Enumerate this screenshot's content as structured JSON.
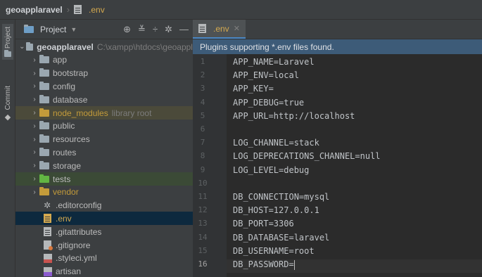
{
  "breadcrumb": {
    "project": "geoapplaravel",
    "file": ".env"
  },
  "toolstrip": {
    "project_label": "Project",
    "commit_label": "Commit"
  },
  "project_panel": {
    "title": "Project",
    "root": {
      "name": "geoapplaravel",
      "path": "C:\\xampp\\htdocs\\geoappl"
    },
    "folders": [
      {
        "name": "app"
      },
      {
        "name": "bootstrap"
      },
      {
        "name": "config"
      },
      {
        "name": "database"
      },
      {
        "name": "node_modules",
        "hint": "library root"
      },
      {
        "name": "public"
      },
      {
        "name": "resources"
      },
      {
        "name": "routes"
      },
      {
        "name": "storage"
      },
      {
        "name": "tests"
      },
      {
        "name": "vendor"
      }
    ],
    "files": [
      {
        "name": ".editorconfig",
        "icon": "gear-icon"
      },
      {
        "name": ".env",
        "icon": "file-icon"
      },
      {
        "name": ".gitattributes",
        "icon": "file-icon"
      },
      {
        "name": ".gitignore",
        "icon": "git-file-icon"
      },
      {
        "name": ".styleci.yml",
        "icon": "yml-file-icon"
      },
      {
        "name": "artisan",
        "icon": "artisan-file-icon"
      }
    ],
    "selected_file": ".env"
  },
  "editor": {
    "tab": {
      "label": ".env"
    },
    "banner": "Plugins supporting *.env files found.",
    "current_line": 16,
    "lines": [
      "APP_NAME=Laravel",
      "APP_ENV=local",
      "APP_KEY=",
      "APP_DEBUG=true",
      "APP_URL=http://localhost",
      "",
      "LOG_CHANNEL=stack",
      "LOG_DEPRECATIONS_CHANNEL=null",
      "LOG_LEVEL=debug",
      "",
      "DB_CONNECTION=mysql",
      "DB_HOST=127.0.0.1",
      "DB_PORT=3306",
      "DB_DATABASE=laravel",
      "DB_USERNAME=root",
      "DB_PASSWORD="
    ],
    "line_numbers": [
      "1",
      "2",
      "3",
      "4",
      "5",
      "6",
      "7",
      "8",
      "9",
      "10",
      "11",
      "12",
      "13",
      "14",
      "15",
      "16"
    ]
  },
  "colors": {
    "accent": "#4a88c7",
    "env_file": "#d4a94f",
    "excluded": "#c39b3a",
    "test_folder": "#62b543"
  }
}
